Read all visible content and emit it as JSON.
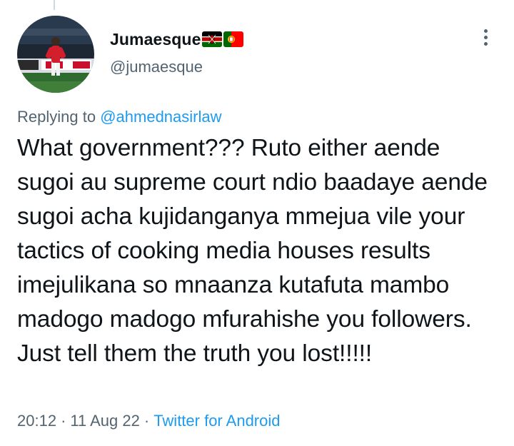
{
  "author": {
    "display_name": "Jumaesque",
    "handle": "@jumaesque",
    "flags": [
      "kenya-flag",
      "portugal-flag"
    ]
  },
  "reply": {
    "prefix": "Replying to",
    "mention": "@ahmednasirlaw"
  },
  "tweet": {
    "text": "What government??? Ruto either aende sugoi au supreme court ndio baadaye aende sugoi acha kujidanganya mmejua vile your tactics of cooking media houses results imejulikana so mnaanza kutafuta mambo madogo madogo mfurahishe you followers. Just tell them the truth you lost!!!!!"
  },
  "meta": {
    "time": "20:12",
    "date": "11 Aug 22",
    "separator": "·",
    "source": "Twitter for Android"
  },
  "colors": {
    "text": "#0f1419",
    "secondary": "#536471",
    "link": "#1d9bf0"
  },
  "icons": {
    "more": "vertical-ellipsis-icon"
  }
}
